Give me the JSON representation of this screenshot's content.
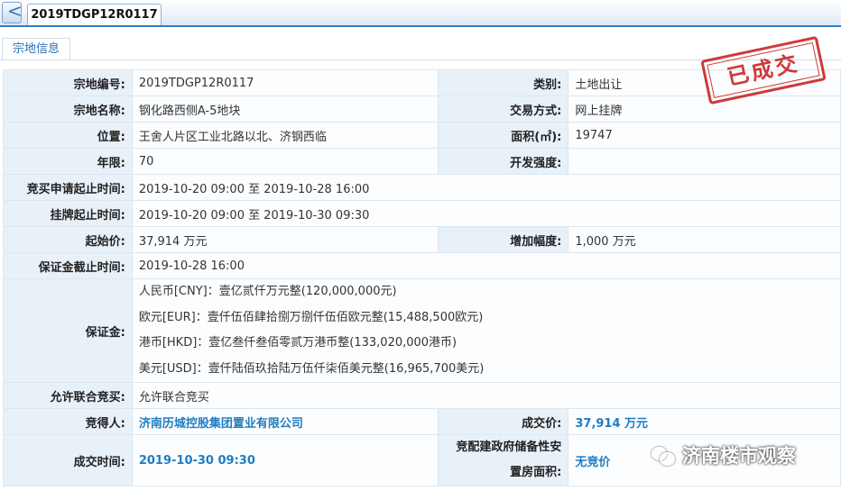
{
  "header": {
    "back_label": "<",
    "tab_title": "2019TDGP12R0117"
  },
  "section_tab": "宗地信息",
  "stamp_text": "已成交",
  "rows": {
    "parcel_no": {
      "label": "宗地编号:",
      "value": "2019TDGP12R0117"
    },
    "category": {
      "label": "类别:",
      "value": "土地出让"
    },
    "parcel_name": {
      "label": "宗地名称:",
      "value": "钢化路西侧A-5地块"
    },
    "trade_method": {
      "label": "交易方式:",
      "value": "网上挂牌"
    },
    "location": {
      "label": "位置:",
      "value": "王舍人片区工业北路以北、济钢西临"
    },
    "area": {
      "label": "面积(㎡):",
      "value": "19747"
    },
    "term": {
      "label": "年限:",
      "value": "70"
    },
    "intensity": {
      "label": "开发强度:",
      "value": ""
    },
    "apply_period": {
      "label": "竞买申请起止时间:",
      "value": "2019-10-20 09:00 至 2019-10-28 16:00"
    },
    "listing_period": {
      "label": "挂牌起止时间:",
      "value": "2019-10-20 09:00 至 2019-10-30 09:30"
    },
    "start_price": {
      "label": "起始价:",
      "value": "37,914 万元"
    },
    "increment": {
      "label": "增加幅度:",
      "value": "1,000 万元"
    },
    "deposit_deadline": {
      "label": "保证金截止时间:",
      "value": "2019-10-28 16:00"
    },
    "deposit": {
      "label": "保证金:",
      "lines": [
        "人民币[CNY]：壹亿贰仟万元整(120,000,000元)",
        "欧元[EUR]：壹仟伍佰肆拾捌万捌仟伍佰欧元整(15,488,500欧元)",
        "港币[HKD]：壹亿叁仟叁佰零贰万港币整(133,020,000港币)",
        "美元[USD]：壹仟陆佰玖拾陆万伍仟柒佰美元整(16,965,700美元)"
      ]
    },
    "joint_bid": {
      "label": "允许联合竞买:",
      "value": "允许联合竞买"
    },
    "winner": {
      "label": "竞得人:",
      "value": "济南历城控股集团置业有限公司"
    },
    "deal_price": {
      "label": "成交价:",
      "value": "37,914 万元"
    },
    "deal_time": {
      "label": "成交时间:",
      "value": "2019-10-30 09:30"
    },
    "housing_area": {
      "label_line1": "竞配建政府储备性安",
      "label_line2": "置房面积:",
      "value": "无竞价"
    }
  },
  "watermark": "济南楼市观察"
}
